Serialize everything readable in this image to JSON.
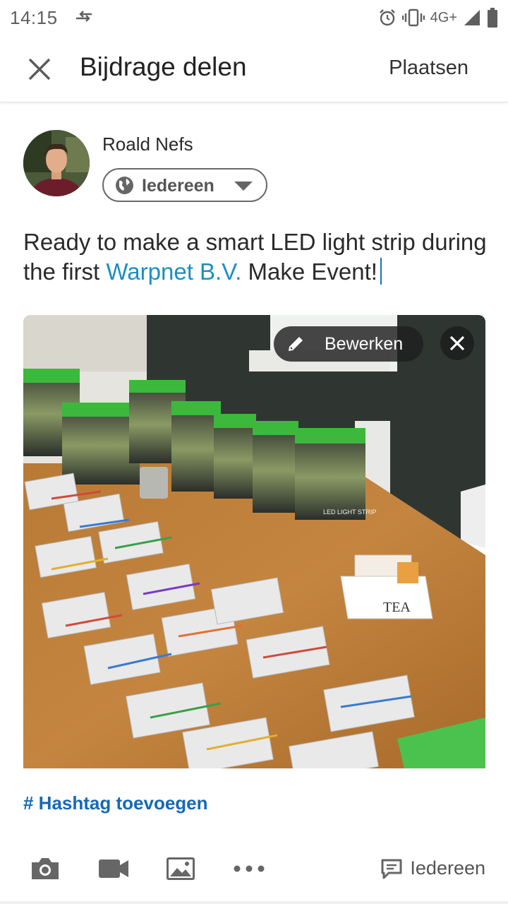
{
  "status_bar": {
    "time": "14:15",
    "network": "4G+",
    "icons": [
      "data-saver-icon",
      "alarm-icon",
      "vibrate-icon",
      "signal-icon",
      "battery-icon"
    ]
  },
  "header": {
    "title": "Bijdrage delen",
    "post_label": "Plaatsen",
    "close_icon": "close-icon"
  },
  "author": {
    "name": "Roald Nefs",
    "visibility": "Iedereen"
  },
  "post": {
    "text_before": "Ready to make a smart LED light strip during the first ",
    "mention": "Warpnet B.V.",
    "text_after": " Make Event!"
  },
  "image": {
    "edit_label": "Bewerken",
    "box_label": "LED LIGHT STRIP",
    "tea_label": "TEA"
  },
  "hashtag": {
    "label": "# Hashtag toevoegen"
  },
  "toolbar": {
    "visibility_label": "Iedereen",
    "icons": [
      "camera-icon",
      "video-icon",
      "photo-icon",
      "more-icon",
      "comment-icon"
    ]
  },
  "colors": {
    "mention": "#1b8ec4",
    "hashtag": "#1569b8",
    "overlay": "#1e1e1e"
  }
}
